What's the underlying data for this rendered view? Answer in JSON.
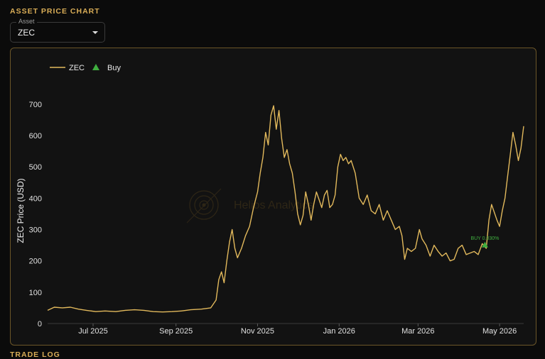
{
  "header": {
    "title": "ASSET PRICE CHART"
  },
  "asset_select": {
    "label": "Asset",
    "value": "ZEC"
  },
  "watermark": {
    "text": "Helios Analytics"
  },
  "next_section": {
    "title": "TRADE LOG"
  },
  "colors": {
    "accent": "#d9ad57",
    "price_line": "#e2b95c",
    "buy_marker": "#3fae3f",
    "background": "#121212"
  },
  "chart_data": {
    "type": "line",
    "title": "",
    "xlabel": "",
    "ylabel": "ZEC Price (USD)",
    "x_range": [
      "2025-05-28",
      "2026-05-19"
    ],
    "ylim": [
      0,
      720
    ],
    "yticks": [
      0,
      100,
      200,
      300,
      400,
      500,
      600,
      700
    ],
    "xticks": [
      {
        "date": "2025-07-01",
        "label": "Jul 2025"
      },
      {
        "date": "2025-09-01",
        "label": "Sep 2025"
      },
      {
        "date": "2025-11-01",
        "label": "Nov 2025"
      },
      {
        "date": "2026-01-01",
        "label": "Jan 2026"
      },
      {
        "date": "2026-03-01",
        "label": "Mar 2026"
      },
      {
        "date": "2026-05-01",
        "label": "May 2026"
      }
    ],
    "legend_position": "top-left",
    "legend": [
      {
        "name": "ZEC",
        "kind": "line"
      },
      {
        "name": "Buy",
        "kind": "triangle"
      }
    ],
    "series": [
      {
        "name": "ZEC",
        "points": [
          [
            "2025-05-28",
            42
          ],
          [
            "2025-06-02",
            52
          ],
          [
            "2025-06-08",
            50
          ],
          [
            "2025-06-14",
            52
          ],
          [
            "2025-06-20",
            46
          ],
          [
            "2025-06-26",
            42
          ],
          [
            "2025-07-03",
            38
          ],
          [
            "2025-07-10",
            40
          ],
          [
            "2025-07-18",
            38
          ],
          [
            "2025-07-25",
            42
          ],
          [
            "2025-08-01",
            44
          ],
          [
            "2025-08-08",
            42
          ],
          [
            "2025-08-15",
            38
          ],
          [
            "2025-08-22",
            37
          ],
          [
            "2025-08-29",
            38
          ],
          [
            "2025-09-05",
            40
          ],
          [
            "2025-09-12",
            44
          ],
          [
            "2025-09-20",
            46
          ],
          [
            "2025-09-27",
            50
          ],
          [
            "2025-10-01",
            75
          ],
          [
            "2025-10-03",
            140
          ],
          [
            "2025-10-05",
            165
          ],
          [
            "2025-10-07",
            130
          ],
          [
            "2025-10-09",
            200
          ],
          [
            "2025-10-11",
            260
          ],
          [
            "2025-10-13",
            300
          ],
          [
            "2025-10-15",
            240
          ],
          [
            "2025-10-17",
            210
          ],
          [
            "2025-10-20",
            240
          ],
          [
            "2025-10-23",
            280
          ],
          [
            "2025-10-26",
            310
          ],
          [
            "2025-10-29",
            370
          ],
          [
            "2025-11-01",
            420
          ],
          [
            "2025-11-03",
            480
          ],
          [
            "2025-11-05",
            530
          ],
          [
            "2025-11-07",
            610
          ],
          [
            "2025-11-09",
            570
          ],
          [
            "2025-11-11",
            665
          ],
          [
            "2025-11-13",
            695
          ],
          [
            "2025-11-15",
            620
          ],
          [
            "2025-11-17",
            680
          ],
          [
            "2025-11-19",
            590
          ],
          [
            "2025-11-21",
            530
          ],
          [
            "2025-11-23",
            555
          ],
          [
            "2025-11-25",
            510
          ],
          [
            "2025-11-27",
            480
          ],
          [
            "2025-11-29",
            420
          ],
          [
            "2025-12-01",
            350
          ],
          [
            "2025-12-03",
            315
          ],
          [
            "2025-12-05",
            345
          ],
          [
            "2025-12-07",
            420
          ],
          [
            "2025-12-09",
            380
          ],
          [
            "2025-12-11",
            330
          ],
          [
            "2025-12-13",
            380
          ],
          [
            "2025-12-15",
            420
          ],
          [
            "2025-12-17",
            395
          ],
          [
            "2025-12-19",
            370
          ],
          [
            "2025-12-21",
            410
          ],
          [
            "2025-12-23",
            425
          ],
          [
            "2025-12-25",
            370
          ],
          [
            "2025-12-27",
            380
          ],
          [
            "2025-12-29",
            410
          ],
          [
            "2025-12-31",
            500
          ],
          [
            "2026-01-02",
            540
          ],
          [
            "2026-01-04",
            520
          ],
          [
            "2026-01-06",
            530
          ],
          [
            "2026-01-08",
            510
          ],
          [
            "2026-01-10",
            520
          ],
          [
            "2026-01-13",
            480
          ],
          [
            "2026-01-16",
            400
          ],
          [
            "2026-01-19",
            380
          ],
          [
            "2026-01-22",
            410
          ],
          [
            "2026-01-25",
            360
          ],
          [
            "2026-01-28",
            350
          ],
          [
            "2026-01-31",
            380
          ],
          [
            "2026-02-03",
            330
          ],
          [
            "2026-02-06",
            360
          ],
          [
            "2026-02-09",
            330
          ],
          [
            "2026-02-12",
            300
          ],
          [
            "2026-02-15",
            310
          ],
          [
            "2026-02-17",
            280
          ],
          [
            "2026-02-19",
            205
          ],
          [
            "2026-02-21",
            240
          ],
          [
            "2026-02-24",
            230
          ],
          [
            "2026-02-27",
            240
          ],
          [
            "2026-03-02",
            300
          ],
          [
            "2026-03-04",
            270
          ],
          [
            "2026-03-07",
            250
          ],
          [
            "2026-03-10",
            215
          ],
          [
            "2026-03-13",
            250
          ],
          [
            "2026-03-16",
            230
          ],
          [
            "2026-03-19",
            215
          ],
          [
            "2026-03-22",
            225
          ],
          [
            "2026-03-25",
            200
          ],
          [
            "2026-03-28",
            205
          ],
          [
            "2026-03-31",
            240
          ],
          [
            "2026-04-03",
            250
          ],
          [
            "2026-04-06",
            220
          ],
          [
            "2026-04-09",
            225
          ],
          [
            "2026-04-12",
            230
          ],
          [
            "2026-04-15",
            220
          ],
          [
            "2026-04-18",
            255
          ],
          [
            "2026-04-21",
            240
          ],
          [
            "2026-04-23",
            330
          ],
          [
            "2026-04-25",
            380
          ],
          [
            "2026-04-27",
            355
          ],
          [
            "2026-04-29",
            330
          ],
          [
            "2026-05-01",
            310
          ],
          [
            "2026-05-03",
            360
          ],
          [
            "2026-05-05",
            400
          ],
          [
            "2026-05-07",
            470
          ],
          [
            "2026-05-09",
            540
          ],
          [
            "2026-05-11",
            610
          ],
          [
            "2026-05-13",
            570
          ],
          [
            "2026-05-15",
            520
          ],
          [
            "2026-05-17",
            560
          ],
          [
            "2026-05-19",
            630
          ]
        ]
      }
    ],
    "annotations": [
      {
        "type": "buy",
        "date": "2026-04-20",
        "value": 245,
        "label": "BUY 0.030%"
      }
    ]
  }
}
